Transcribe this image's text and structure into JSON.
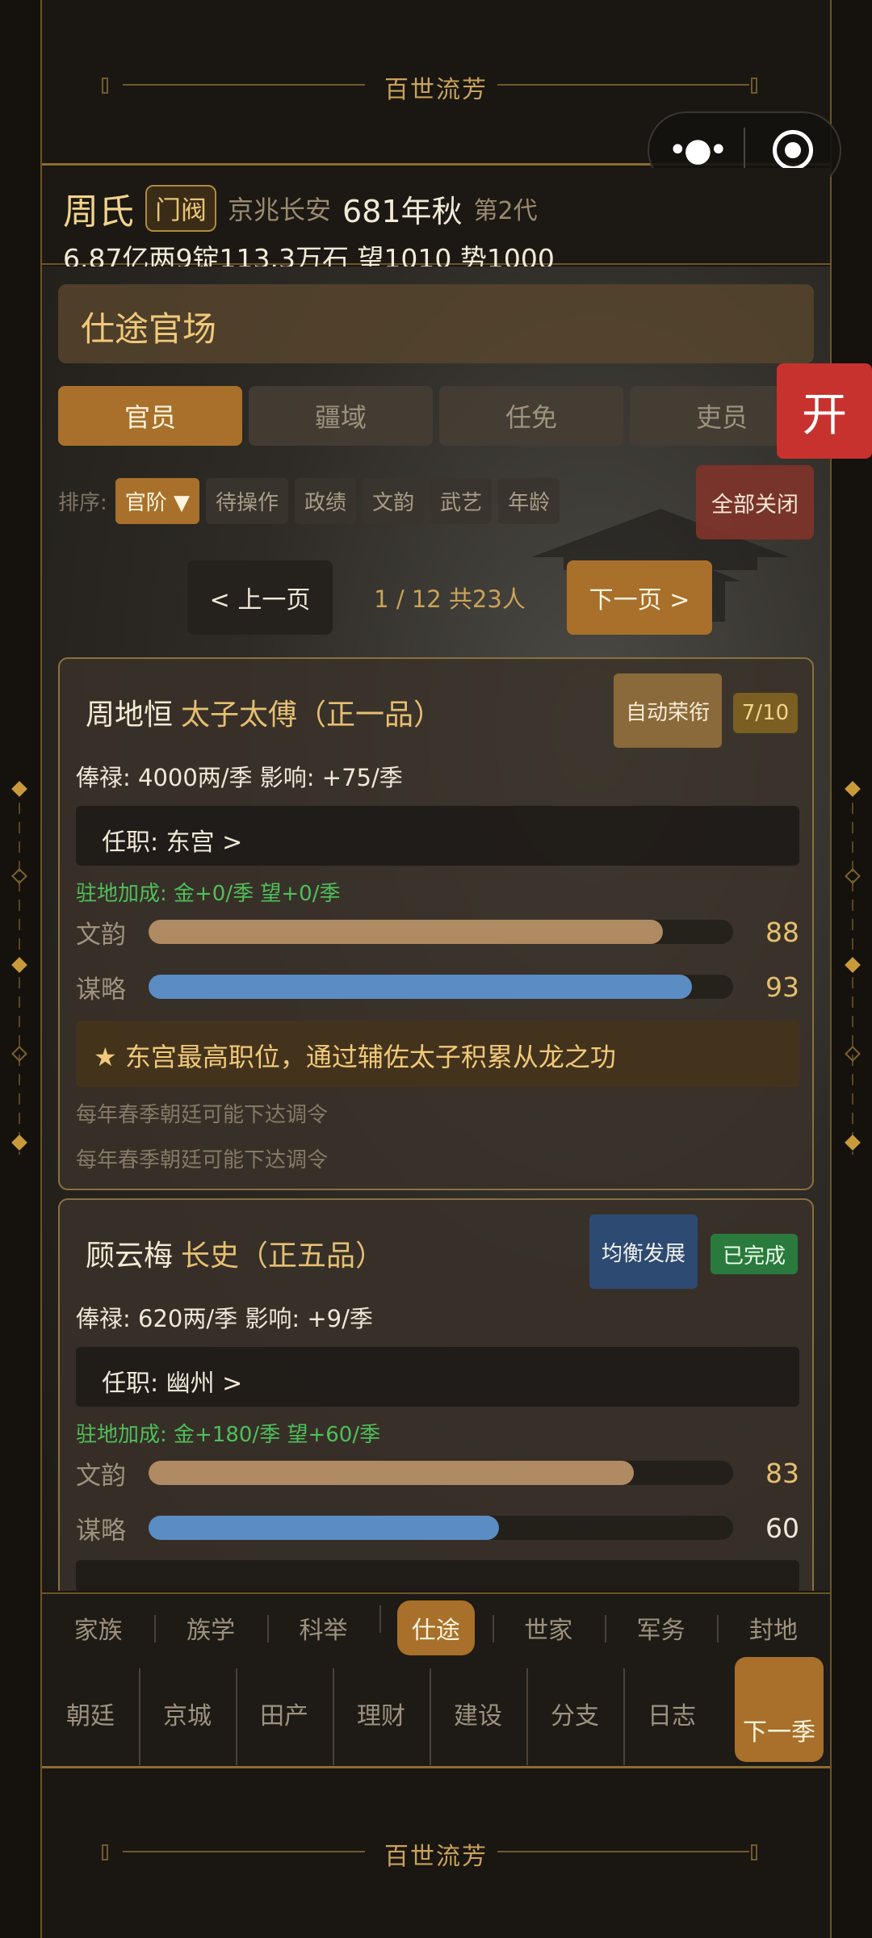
{
  "banner": {
    "title": "百世流芳"
  },
  "capsule": {
    "menu_icon": "more-dots-icon",
    "close_icon": "target-icon"
  },
  "status": {
    "family": "周氏",
    "rank": "门阀",
    "place": "京兆长安",
    "year": "681年秋",
    "generation": "第2代",
    "resources": "6.87亿两9锭113.3万石  望1010 势1000"
  },
  "section": {
    "title": "仕途官场"
  },
  "tabs": [
    {
      "label": "官员",
      "active": true
    },
    {
      "label": "疆域",
      "active": false
    },
    {
      "label": "任免",
      "active": false
    },
    {
      "label": "吏员",
      "active": false
    }
  ],
  "open_button": "开",
  "sort": {
    "label": "排序:",
    "options": [
      {
        "label": "官阶 ▼",
        "active": true
      },
      {
        "label": "待操作",
        "active": false
      },
      {
        "label": "政绩",
        "active": false
      },
      {
        "label": "文韵",
        "active": false
      },
      {
        "label": "武艺",
        "active": false
      },
      {
        "label": "年龄",
        "active": false
      }
    ],
    "close_all": "全部关闭"
  },
  "pager": {
    "prev": "< 上一页",
    "info": "1 / 12  共23人",
    "next": "下一页 >"
  },
  "officials": [
    {
      "name": "周地恒",
      "title": "太子太傅（正一品）",
      "tag": "自动荣衔",
      "badge": "7/10",
      "salary": "俸禄: 4000两/季   影响: +75/季",
      "post": "任职: 东宫   >",
      "bonus": "驻地加成: 金+0/季  望+0/季",
      "stats": [
        {
          "label": "文韵",
          "value": 88,
          "color": "#b08a62",
          "value_color": "#e5bf72"
        },
        {
          "label": "谋略",
          "value": 93,
          "color": "#5b8cc4",
          "value_color": "#e5bf72"
        }
      ],
      "note": "★ 东宫最高职位，通过辅佐太子积累从龙之功",
      "hints": [
        "每年春季朝廷可能下达调令",
        "每年春季朝廷可能下达调令"
      ]
    },
    {
      "name": "顾云梅",
      "title": "长史（正五品）",
      "tag": "均衡发展",
      "badge": "已完成",
      "salary": "俸禄: 620两/季   影响: +9/季",
      "post": "任职: 幽州   >",
      "bonus": "驻地加成: 金+180/季  望+60/季",
      "stats": [
        {
          "label": "文韵",
          "value": 83,
          "color": "#b08a62",
          "value_color": "#e5bf72"
        },
        {
          "label": "谋略",
          "value": 60,
          "color": "#5b8cc4",
          "value_color": "#f0e8d8"
        }
      ]
    }
  ],
  "nav": {
    "row1": [
      {
        "label": "家族",
        "active": false
      },
      {
        "label": "族学",
        "active": false
      },
      {
        "label": "科举",
        "active": false
      },
      {
        "label": "仕途",
        "active": true
      },
      {
        "label": "世家",
        "active": false
      },
      {
        "label": "军务",
        "active": false
      },
      {
        "label": "封地",
        "active": false
      }
    ],
    "row2": [
      "朝廷",
      "京城",
      "田产",
      "理财",
      "建设",
      "分支",
      "日志"
    ],
    "next_season": "下一季"
  }
}
